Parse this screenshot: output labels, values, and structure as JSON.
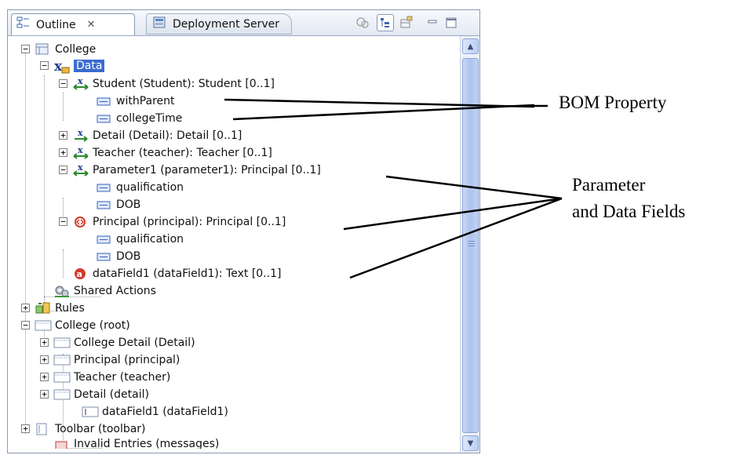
{
  "tabs": {
    "outline": "Outline",
    "close_glyph": "✕",
    "deployment": "Deployment Server"
  },
  "tree": {
    "college": "College",
    "data": "Data",
    "student": "Student (Student): Student [0..1]",
    "withParent": "withParent",
    "collegeTime": "collegeTime",
    "detail": "Detail (Detail): Detail [0..1]",
    "teacher": "Teacher (teacher): Teacher [0..1]",
    "parameter1": "Parameter1 (parameter1): Principal [0..1]",
    "qualification1": "qualification",
    "dob1": "DOB",
    "principal": "Principal (principal): Principal [0..1]",
    "qualification2": "qualification",
    "dob2": "DOB",
    "dataField1": "dataField1 (dataField1): Text [0..1]",
    "sharedActions": "Shared Actions",
    "rules": "Rules",
    "collegeRoot": "College (root)",
    "collegeDetail": "College Detail (Detail)",
    "principalPrincipal": "Principal (principal)",
    "teacherTeacher": "Teacher (teacher)",
    "detailDetail": "Detail (detail)",
    "dataField1Field": "dataField1 (dataField1)",
    "toolbar": "Toolbar (toolbar)",
    "invalidEntries": "Invalid Entries (messages)"
  },
  "annotations": {
    "bom_property": "BOM Property",
    "parameter_line1": "Parameter",
    "parameter_line2": "and Data Fields"
  },
  "colors": {
    "selection": "#3a6cd0",
    "panel_border": "#8a9ab3"
  }
}
